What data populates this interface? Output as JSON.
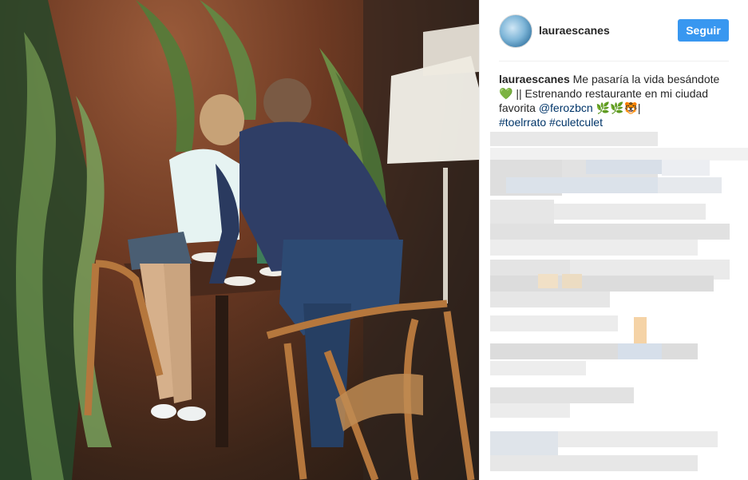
{
  "post": {
    "username": "lauraescanes",
    "follow_label": "Seguir",
    "caption": {
      "username": "lauraescanes",
      "text_1": "Me pasaría la vida besándote",
      "heart": "💚",
      "text_2": "|| Estrenando restaurante en mi ciudad favorita",
      "mention": "@ferozbcn",
      "emojis": "🌿🌿🐯|",
      "hashtag_1": "#toelrrato",
      "hashtag_2": "#culetculet"
    }
  },
  "colors": {
    "follow_button": "#3897f0",
    "link": "#003569",
    "text": "#262626"
  }
}
